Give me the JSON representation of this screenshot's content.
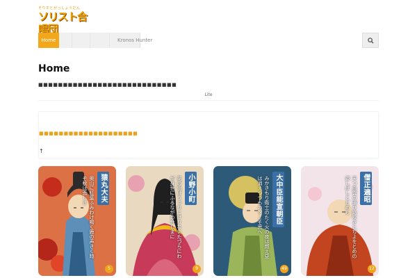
{
  "logo": {
    "ruby": "そりすとがっしょうだん",
    "text": "ソリスト合唱団"
  },
  "nav": {
    "home_label": "Home",
    "item_label": "Kronos Hunter"
  },
  "page": {
    "title": "Home",
    "description": "■■■■■■■■■■■■■■■■■■■■■■■■■■■■",
    "lite_label": "Lite",
    "notice_link": "■■■■■■■■■■■■■■■■■■■■",
    "arrow": "↑"
  },
  "cards": [
    {
      "name": "猿丸大夫",
      "poem": "奥山に紅葉ふみわけ鳴く鹿の声きく時ぞ秋は悲しき",
      "number": "5"
    },
    {
      "name": "小野小町",
      "poem": "花の色はうつりにけりないたづらにわが身世にふるながめせしまに",
      "number": "9"
    },
    {
      "name": "大中臣能宣朝臣",
      "poem": "みかきもり衛士のたく火の夜は燃え昼は消えつつものをこそ思へ",
      "number": "49"
    },
    {
      "name": "僧正遍昭",
      "poem": "天つ風雲の通ひ路吹きとぢよをとめの姿しばしとどめむ",
      "number": "12"
    }
  ],
  "colors": {
    "accent": "#f3a81c",
    "link": "#e8a21f",
    "name_tag": "#3a6fa8"
  }
}
